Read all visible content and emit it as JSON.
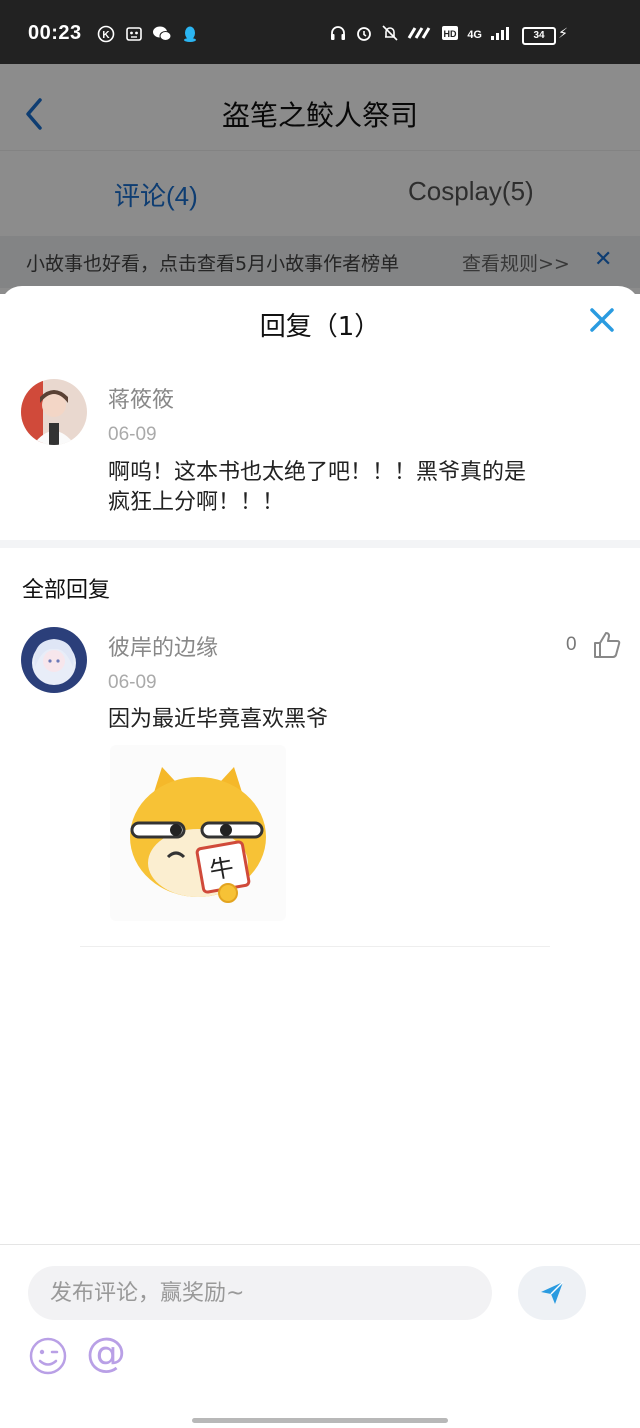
{
  "status_bar": {
    "time": "00:23",
    "battery": "34",
    "network": "4G",
    "left_icons": [
      "k-icon",
      "robot-icon",
      "wechat-icon",
      "qq-icon"
    ],
    "right_icons": [
      "headphones-icon",
      "alarm-icon",
      "mute-icon",
      "signal-icon",
      "hd-icon"
    ]
  },
  "header": {
    "title": "盗笔之鲛人祭司",
    "back_icon": "chevron-left-icon"
  },
  "tabs": [
    {
      "label": "评论(4)",
      "active": true
    },
    {
      "label": "Cosplay(5)",
      "active": false
    }
  ],
  "banner": {
    "text": "小故事也好看，点击查看5月小故事作者榜单",
    "link": "查看规则>>",
    "close": "✕"
  },
  "sheet": {
    "title": "回复（1）",
    "close_icon": "close-icon",
    "original_comment": {
      "user": "蒋筱筱",
      "date": "06-09",
      "text_line1": "啊呜！这本书也太绝了吧！！！黑爷真的是",
      "text_line2": "疯狂上分啊！！！"
    },
    "section_title": "全部回复",
    "replies": [
      {
        "user": "彼岸的边缘",
        "date": "06-09",
        "text": "因为最近毕竟喜欢黑爷",
        "likes": "0",
        "sticker_text": "牛"
      }
    ]
  },
  "input": {
    "placeholder": "发布评论，赢奖励~",
    "value": ""
  },
  "colors": {
    "accent": "#1a6fcf",
    "close_blue": "#2a9be0",
    "emoji_purple": "#b9a0e6"
  }
}
